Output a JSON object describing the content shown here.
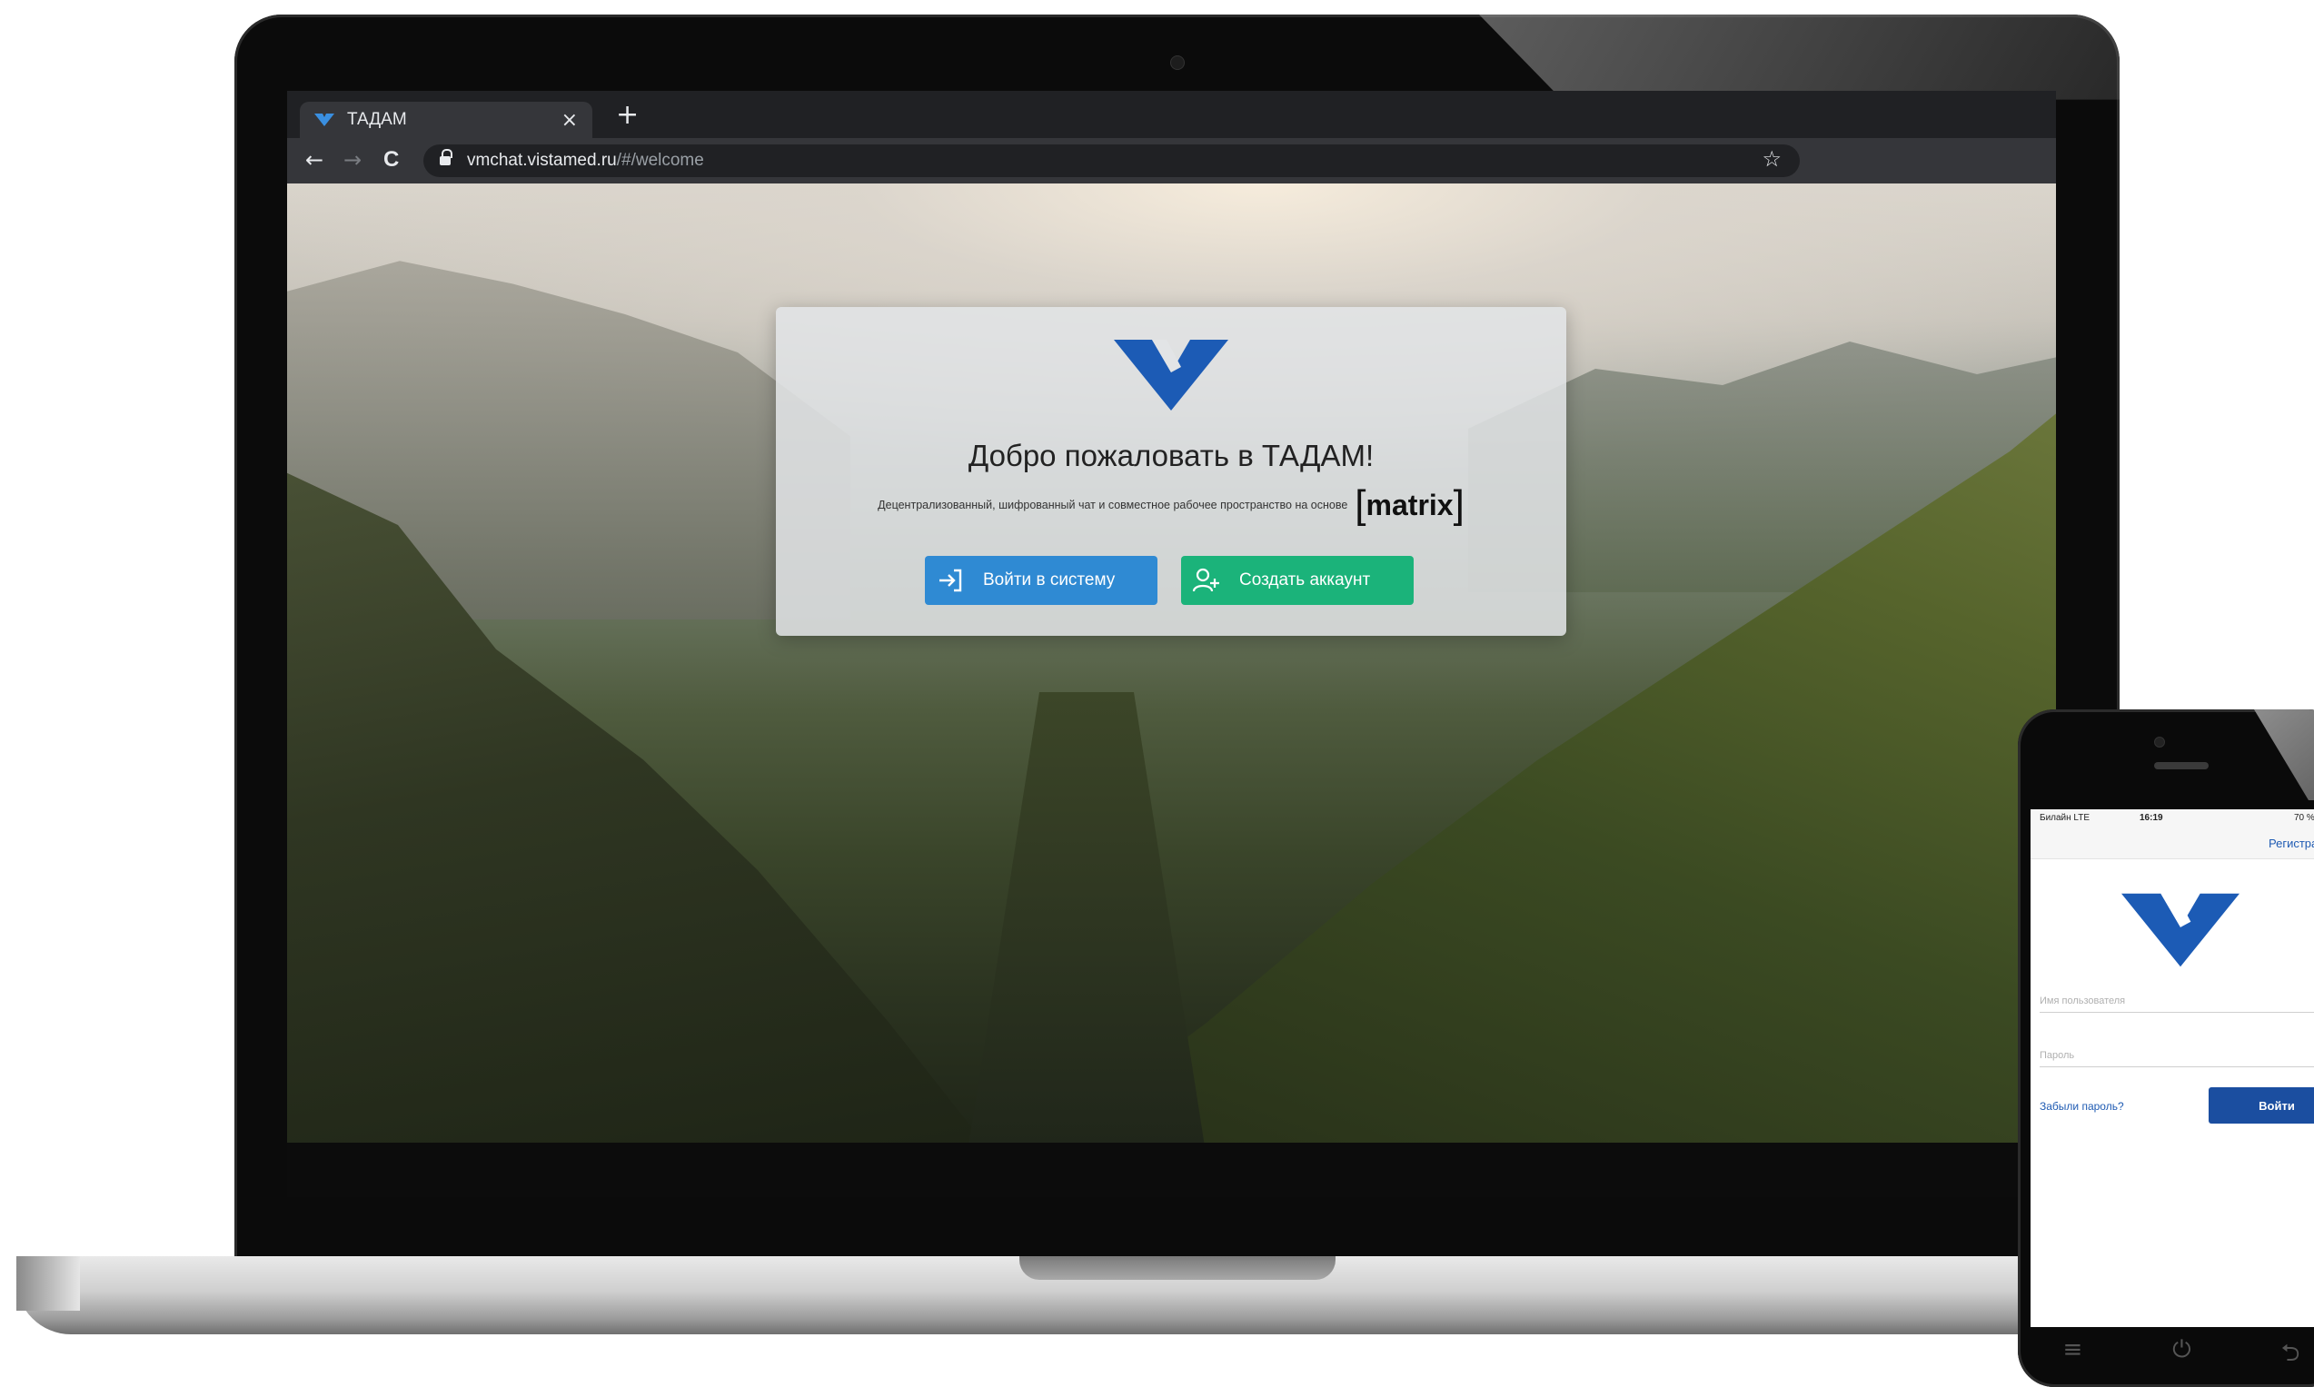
{
  "browser": {
    "tab_title": "ТАДАМ",
    "tab_close": "×",
    "new_tab": "+",
    "nav_back": "←",
    "nav_forward": "→",
    "nav_reload": "C",
    "url_host": "vmchat.vistamed.ru",
    "url_path": "/#/welcome",
    "bookmark_icon": "☆"
  },
  "welcome": {
    "title": "Добро пожаловать в ТАДАМ!",
    "subtitle": "Децентрализованный, шифрованный чат и совместное рабочее пространство на основе",
    "matrix_logo": "matrix",
    "login_button": "Войти в систему",
    "register_button": "Создать аккаунт"
  },
  "phone": {
    "status_carrier": "Билайн  LTE",
    "status_time": "16:19",
    "status_battery": "70 %",
    "register_link": "Регистрация",
    "username_placeholder": "Имя пользователя",
    "password_placeholder": "Пароль",
    "forgot_password": "Забыли пароль?",
    "login_button": "Войти",
    "softkeys": [
      "≡",
      "⏻",
      "⮌"
    ]
  },
  "colors": {
    "brand_blue": "#1f5bb3",
    "login_button": "#2f8ad3",
    "register_button": "#1bb37a"
  },
  "icons": [
    "tab-favicon-icon",
    "lock-icon",
    "star-icon",
    "login-icon",
    "add-user-icon",
    "logo-icon"
  ]
}
